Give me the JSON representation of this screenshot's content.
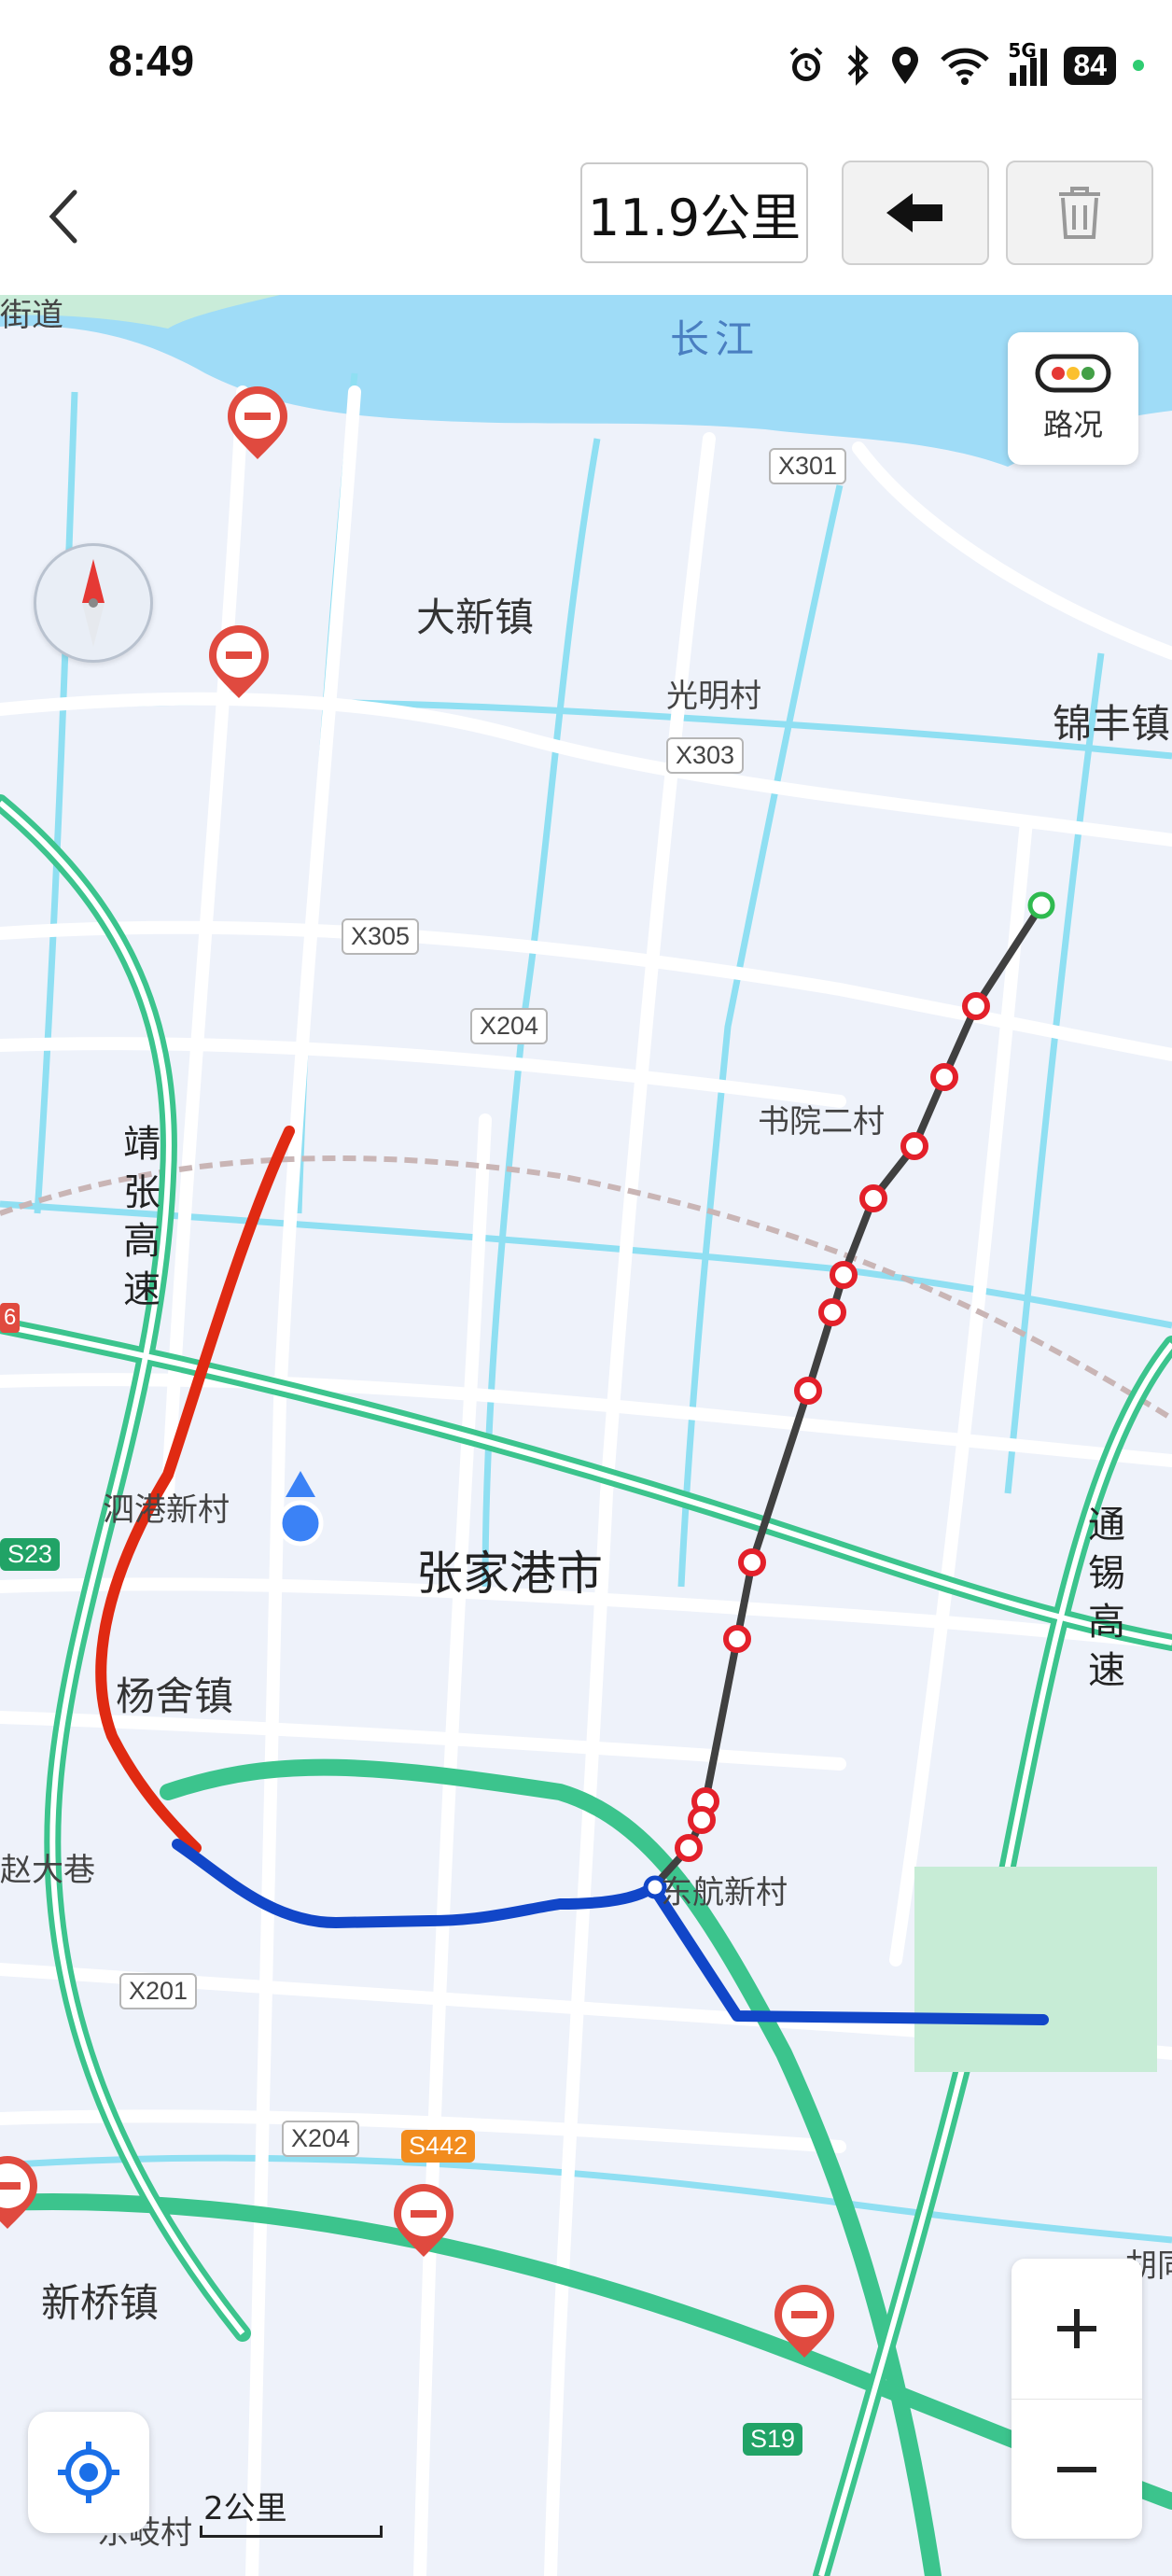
{
  "status_bar": {
    "time": "8:49",
    "battery": "84",
    "network": "5G"
  },
  "toolbar": {
    "distance": "11.9公里"
  },
  "traffic_button": {
    "label": "路况"
  },
  "map": {
    "river_label": "长江",
    "place_labels": {
      "daxin": "大新镇",
      "guangming": "光明村",
      "jinfeng": "锦丰镇",
      "shuyuan": "书院二村",
      "sigang": "泗港新村",
      "zhangjiagang": "张家港市",
      "yangshe": "杨舍镇",
      "zhaodaxiang": "赵大巷",
      "donghang": "东航新村",
      "xinqiao": "新桥镇",
      "dongqi": "东岐村",
      "hu": "胡同",
      "top_left": "街道"
    },
    "road_shields": {
      "x301": "X301",
      "x303": "X303",
      "x305": "X305",
      "x204a": "X204",
      "x204b": "X204",
      "x201": "X201",
      "s442": "S442",
      "s19": "S19",
      "s23": "S23",
      "edge": "6"
    },
    "highway_labels": {
      "jingzhang": "靖张高速",
      "tongxi": "通锡高速"
    },
    "scale": "2公里"
  },
  "routes": {
    "gray_waypoint_count": 12
  },
  "colors": {
    "route_red": "#e02a12",
    "route_blue": "#1146c8",
    "route_gray": "#404040",
    "highway": "#3cc48d",
    "water": "#9fdcf7",
    "land": "#eef2fa",
    "accent": "#3b82f6"
  }
}
